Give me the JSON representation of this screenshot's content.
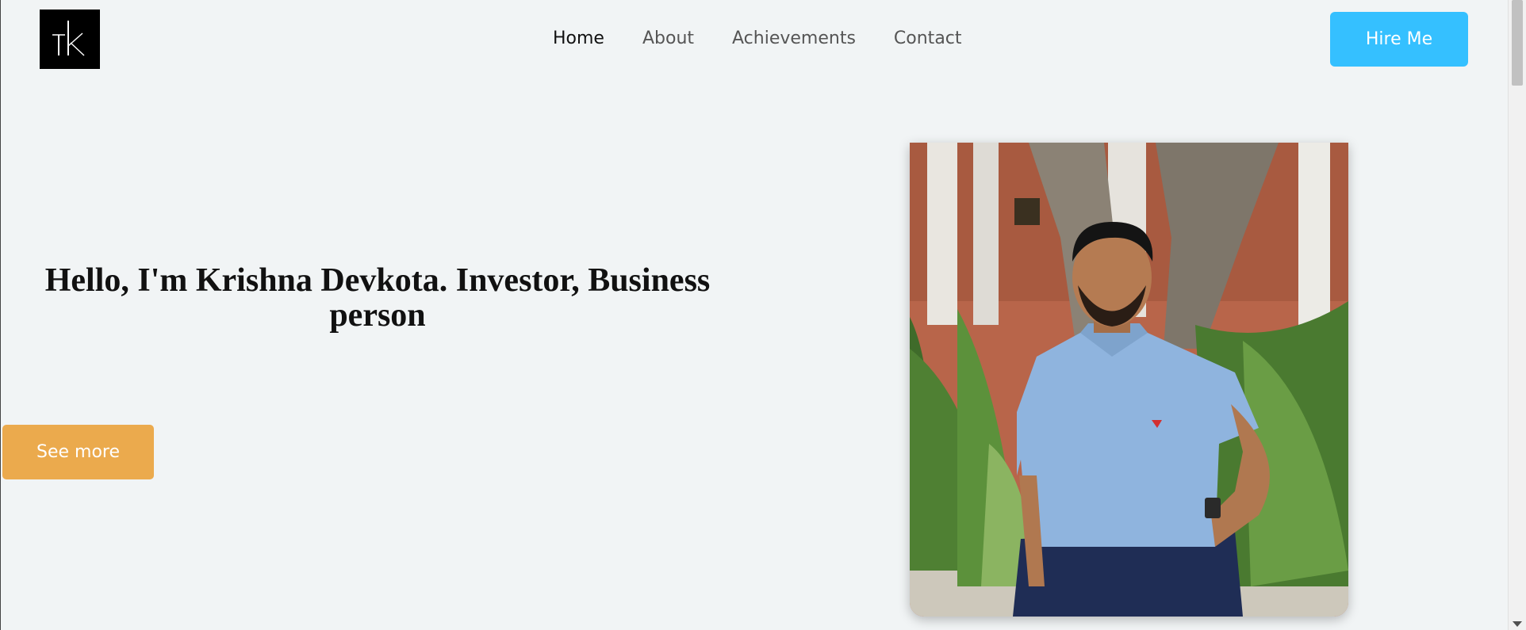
{
  "header": {
    "logo_alt": "TK",
    "nav": [
      {
        "label": "Home",
        "active": true
      },
      {
        "label": "About",
        "active": false
      },
      {
        "label": "Achievements",
        "active": false
      },
      {
        "label": "Contact",
        "active": false
      }
    ],
    "hire_label": "Hire Me"
  },
  "hero": {
    "headline": "Hello, I'm Krishna Devkota. Investor, Business person",
    "see_more_label": "See more",
    "photo_description": "portrait"
  },
  "colors": {
    "background": "#f1f4f5",
    "hire_button": "#35c0ff",
    "see_more_button": "#ebaa4d",
    "logo_bg": "#000000"
  },
  "icons": {
    "logo": "tk-monogram-icon",
    "scroll_down": "chevron-down-icon"
  }
}
